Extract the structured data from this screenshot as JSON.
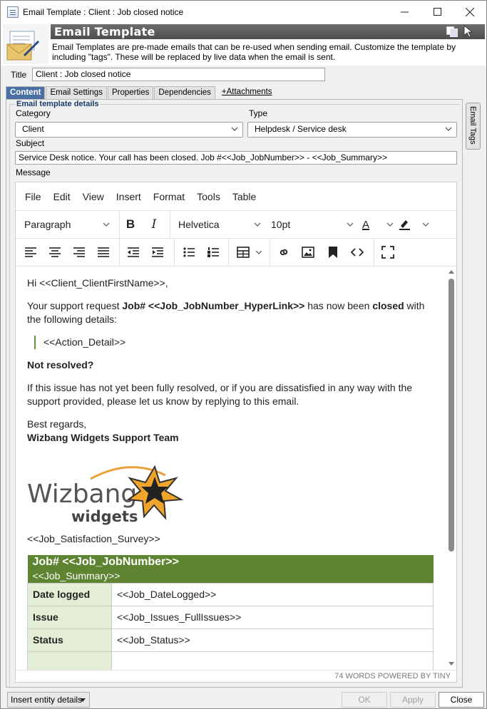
{
  "window": {
    "title": "Email Template : Client : Job closed notice",
    "minimize": "—",
    "maximize": "☐",
    "close": "✕"
  },
  "banner": {
    "title": "Email Template",
    "description": "Email Templates are pre-made emails that can be re-used when sending email.  Customize the template by including \"tags\".  These will be replaced by live data when the email is sent."
  },
  "title_field": {
    "label": "Title",
    "value": "Client : Job closed notice"
  },
  "tabs": [
    {
      "label": "Content"
    },
    {
      "label": "Email Settings"
    },
    {
      "label": "Properties"
    },
    {
      "label": "Dependencies"
    },
    {
      "label": "+Attachments"
    }
  ],
  "group": {
    "legend": "Email template details"
  },
  "category": {
    "label": "Category",
    "value": "Client"
  },
  "type": {
    "label": "Type",
    "value": "Helpdesk / Service desk"
  },
  "subject": {
    "label": "Subject",
    "value": "Service Desk notice.  Your call has been closed.  Job #<<Job_JobNumber>> - <<Job_Summary>>"
  },
  "message": {
    "label": "Message"
  },
  "side_tab": {
    "label": "Email Tags"
  },
  "editor": {
    "menu": [
      "File",
      "Edit",
      "View",
      "Insert",
      "Format",
      "Tools",
      "Table"
    ],
    "block_format": "Paragraph",
    "font_family": "Helvetica",
    "font_size": "10pt",
    "bold": "B",
    "italic": "I",
    "text_color_letter": "A",
    "status": "74 WORDS  POWERED BY TINY"
  },
  "body": {
    "greeting": "Hi <<Client_ClientFirstName>>,",
    "p1_a": "Your support request ",
    "p1_b": "Job# <<Job_JobNumber_HyperLink>>",
    "p1_c": " has now been ",
    "p1_d": "closed",
    "p1_e": " with the following details:",
    "quote": "<<Action_Detail>>",
    "not_resolved": "Not resolved?",
    "p2": "If this issue has not yet been fully resolved, or if you are dissatisfied in any way with the support provided, please let us know by replying to this email.",
    "regards": "Best regards,",
    "team": "Wizbang Widgets Support Team",
    "logo_word1": "Wizbang",
    "logo_word2": "widgets",
    "survey": "<<Job_Satisfaction_Survey>>",
    "table_head1": "Job# <<Job_JobNumber>>",
    "table_head2": "<<Job_Summary>>",
    "rows": [
      {
        "k": "Date logged",
        "v": "<<Job_DateLogged>>"
      },
      {
        "k": "Issue",
        "v": "<<Job_Issues_FullIssues>>"
      },
      {
        "k": "Status",
        "v": "<<Job_Status>>"
      },
      {
        "k": "",
        "v": ""
      }
    ]
  },
  "bottom": {
    "insert_entity": "Insert entity details",
    "ok": "OK",
    "apply": "Apply",
    "close": "Close"
  },
  "colors": {
    "accent": "#4a6fa3",
    "table_green": "#5e8432",
    "table_key_bg": "#e3eed5"
  }
}
